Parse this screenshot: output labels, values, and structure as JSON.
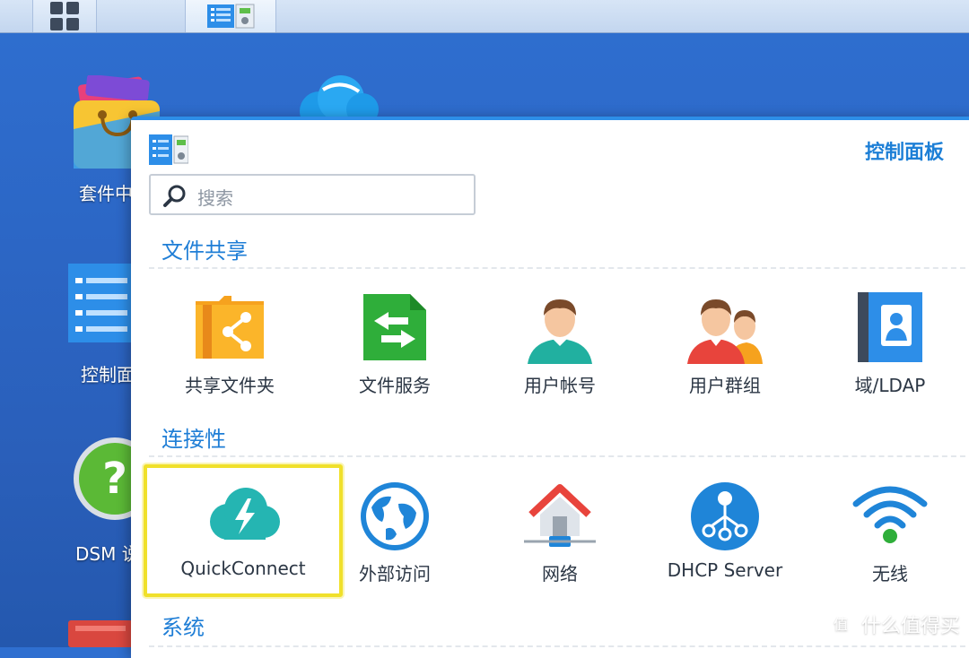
{
  "window": {
    "title": "控制面板",
    "search_placeholder": "搜索"
  },
  "desktop": {
    "icons": [
      {
        "label": "套件中"
      },
      {
        "label": "控制面"
      },
      {
        "label": "DSM 说"
      }
    ]
  },
  "sections": [
    {
      "title": "文件共享",
      "items": [
        {
          "label": "共享文件夹",
          "icon": "shared-folder-icon"
        },
        {
          "label": "文件服务",
          "icon": "file-services-icon"
        },
        {
          "label": "用户帐号",
          "icon": "user-account-icon"
        },
        {
          "label": "用户群组",
          "icon": "user-group-icon"
        },
        {
          "label": "域/LDAP",
          "icon": "domain-ldap-icon"
        }
      ]
    },
    {
      "title": "连接性",
      "items": [
        {
          "label": "QuickConnect",
          "icon": "quickconnect-icon",
          "selected": true
        },
        {
          "label": "外部访问",
          "icon": "external-access-icon"
        },
        {
          "label": "网络",
          "icon": "network-icon"
        },
        {
          "label": "DHCP Server",
          "icon": "dhcp-server-icon"
        },
        {
          "label": "无线",
          "icon": "wireless-icon"
        }
      ]
    },
    {
      "title": "系统"
    }
  ],
  "watermark": {
    "text": "什么值得买"
  },
  "colors": {
    "accent": "#1f7ed6",
    "desktop_bg": "#2c67c6",
    "selection_border": "#f0e02a"
  }
}
